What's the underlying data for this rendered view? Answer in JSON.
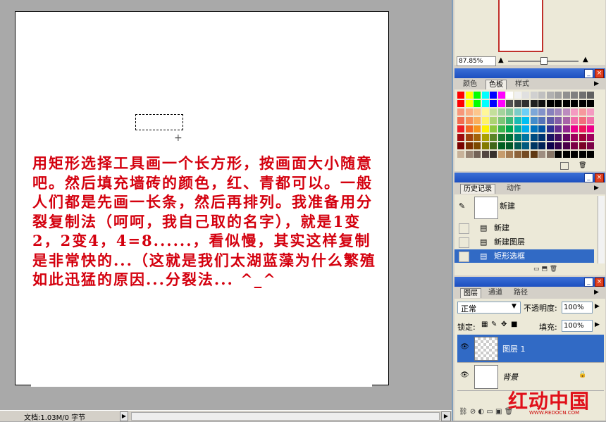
{
  "canvas": {
    "tutorial_text": "用矩形选择工具画一个长方形，按画面大小随意吧。然后填充墙砖的颜色，红、青都可以。一般人们都是先画一长条，然后再排列。我准备用分裂复制法（呵呵，我自己取的名字），就是1变2，2变4，4=8......，看似慢，其实这样复制是非常快的...（这就是我们太湖蓝藻为什么繁殖如此迅猛的原因...分裂法... ^_^"
  },
  "status_bar": {
    "doc_info": "文档:1.03M/0 字节"
  },
  "navigator": {
    "zoom": "87.85%"
  },
  "color_panel": {
    "tabs": [
      "颜色",
      "色板",
      "样式"
    ],
    "active_tab": "色板",
    "swatch_rows": [
      [
        "#ff0000",
        "#ffff00",
        "#00ff00",
        "#00ffff",
        "#0000ff",
        "#ff00ff",
        "#ffffff",
        "#f0f0f0",
        "#e0e0e0",
        "#d0d0d0",
        "#c0c0c0",
        "#b0b0b0",
        "#a0a0a0",
        "#909090",
        "#808080",
        "#707070",
        "#606060"
      ],
      [
        "#ff0000",
        "#ffff00",
        "#00ff00",
        "#00ffff",
        "#0000ff",
        "#ff00ff",
        "#505050",
        "#404040",
        "#303030",
        "#202020",
        "#101010",
        "#000000",
        "#000000",
        "#000000",
        "#000000",
        "#000000",
        "#000000"
      ],
      [
        "#f7977a",
        "#fbad82",
        "#fdc68c",
        "#fff799",
        "#c4df9b",
        "#a3d39c",
        "#82ca9c",
        "#7accc8",
        "#6dcff6",
        "#7da7d8",
        "#8393ca",
        "#8781bd",
        "#a187be",
        "#bc8cbf",
        "#f49ac1",
        "#f6989d",
        "#f49ac1"
      ],
      [
        "#f26c4f",
        "#f68e56",
        "#fbaf5d",
        "#fff467",
        "#acd372",
        "#7cc576",
        "#3bb878",
        "#1abbb4",
        "#00bff3",
        "#438ccb",
        "#5574b9",
        "#605ca8",
        "#855fa8",
        "#a864a8",
        "#f06ea9",
        "#f26d7d",
        "#f06ea9"
      ],
      [
        "#ed1c24",
        "#f26522",
        "#f7941d",
        "#fff200",
        "#8dc73f",
        "#39b54a",
        "#00a651",
        "#00a99d",
        "#00aeef",
        "#0072bc",
        "#0054a5",
        "#2e3192",
        "#662d91",
        "#92278f",
        "#ec008c",
        "#ed145b",
        "#ec008c"
      ],
      [
        "#9e0b0f",
        "#a0410d",
        "#a3620a",
        "#aba000",
        "#598527",
        "#1a7b30",
        "#007236",
        "#00746b",
        "#0076a3",
        "#004b80",
        "#003471",
        "#1b1464",
        "#440e62",
        "#630460",
        "#9e005d",
        "#9e0039",
        "#9e005d"
      ],
      [
        "#790000",
        "#7b2e00",
        "#7d4900",
        "#827b00",
        "#406618",
        "#005e20",
        "#005826",
        "#005952",
        "#005b7f",
        "#003663",
        "#002157",
        "#0d004c",
        "#32004b",
        "#4b0049",
        "#7b0046",
        "#7a0026",
        "#7b0046"
      ],
      [
        "#c7b299",
        "#998675",
        "#736357",
        "#534741",
        "#37302d",
        "#c69c6d",
        "#a67c52",
        "#8c6239",
        "#754c24",
        "#603913",
        "#9e8e80",
        "#867566",
        "#000000",
        "#000000",
        "#000000",
        "#000000",
        "#000000"
      ]
    ]
  },
  "history_panel": {
    "tabs": [
      "历史记录",
      "动作"
    ],
    "active_tab": "历史记录",
    "snapshot_label": "新建",
    "items": [
      {
        "label": "新建",
        "selected": false
      },
      {
        "label": "新建图层",
        "selected": false
      },
      {
        "label": "矩形选框",
        "selected": true
      }
    ]
  },
  "layers_panel": {
    "tabs": [
      "图层",
      "通道",
      "路径"
    ],
    "active_tab": "图层",
    "blend_mode": "正常",
    "opacity_label": "不透明度:",
    "opacity_value": "100%",
    "lock_label": "锁定:",
    "fill_label": "填充:",
    "fill_value": "100%",
    "layers": [
      {
        "name": "图层 1",
        "selected": true,
        "transparent": true
      },
      {
        "name": "背景",
        "selected": false,
        "transparent": false,
        "locked": true
      }
    ]
  },
  "watermark": {
    "text": "红动中国",
    "url_text": "WWW.REDOCN.COM"
  },
  "colors": {
    "accent": "#316ac5",
    "text_red": "#d4000e",
    "panel_bg": "#ece9d8",
    "titlebar": "#2457c8"
  }
}
